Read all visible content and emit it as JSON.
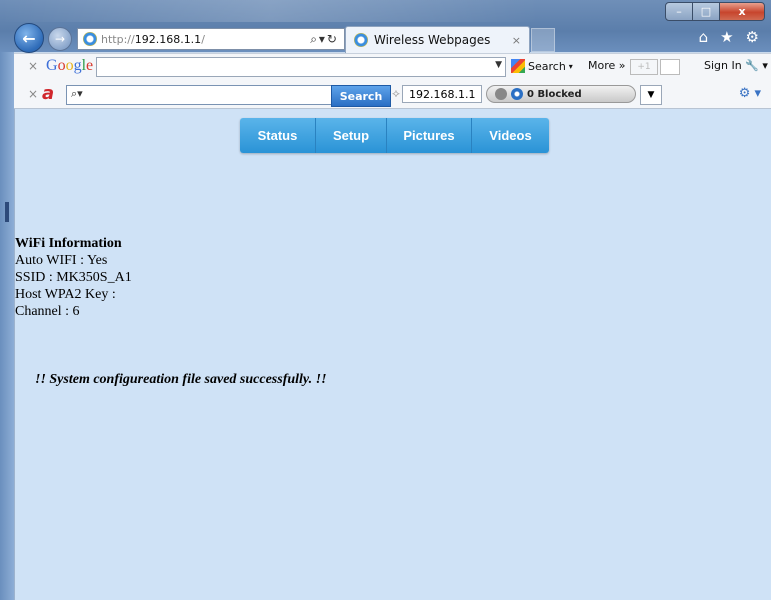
{
  "browser": {
    "address": {
      "protocol": "http://",
      "host": "192.168.1.1",
      "path": "/"
    },
    "tab": {
      "title": "Wireless Webpages",
      "close": "×"
    },
    "window_buttons": {
      "minimize": "–",
      "maximize": "□",
      "close": "x"
    },
    "right_icons": {
      "home": "⌂",
      "favorites": "★",
      "tools": "⚙"
    }
  },
  "google_toolbar": {
    "logo": "Google",
    "search_label": "Search",
    "more_label": "More »",
    "plus_one": "+1",
    "sign_in": "Sign In"
  },
  "ask_toolbar": {
    "search_button": "Search",
    "ip_value": "192.168.1.1",
    "blocked_label": "0 Blocked"
  },
  "nav": {
    "items": [
      {
        "label": "Status"
      },
      {
        "label": "Setup"
      },
      {
        "label": "Pictures"
      },
      {
        "label": "Videos"
      }
    ]
  },
  "wifi": {
    "heading": "WiFi Information",
    "auto_wifi": "Auto WIFI : Yes",
    "ssid": "SSID : MK350S_A1",
    "wpa2": "Host WPA2 Key :",
    "channel": "Channel : 6"
  },
  "message": "!! System configureation file saved successfully. !!"
}
